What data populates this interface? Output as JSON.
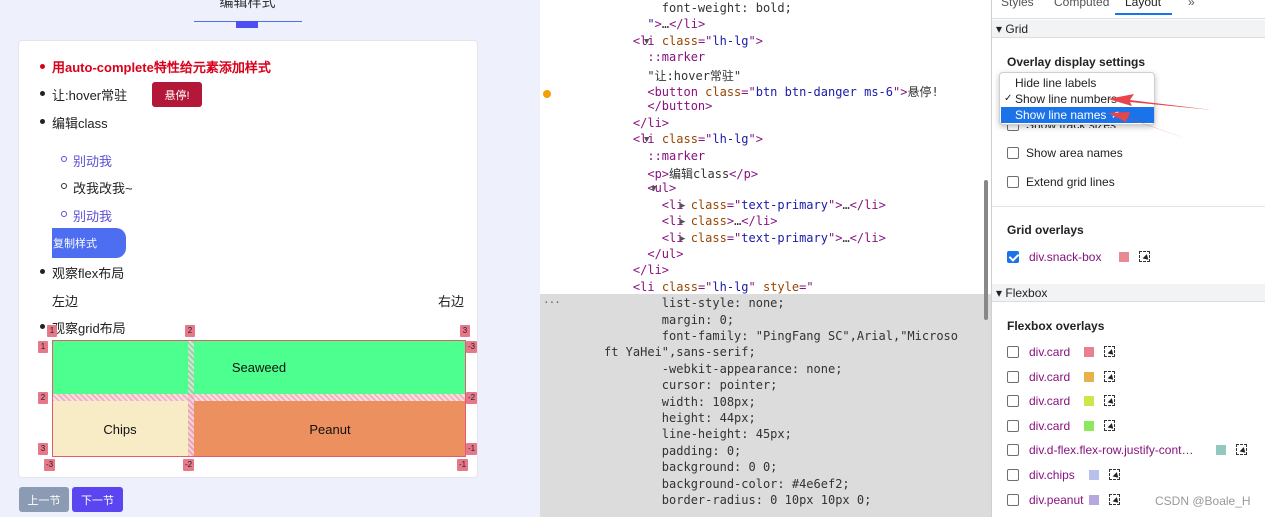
{
  "left": {
    "page_title": "编辑样式",
    "list": [
      {
        "text": "用auto-complete特性给元素添加样式"
      },
      {
        "text": "让:hover常驻",
        "button": "悬停!"
      },
      {
        "text": "编辑class"
      }
    ],
    "sublist": [
      "别动我",
      "改我改我~",
      "别动我"
    ],
    "copy_button": "复制样式",
    "flex_item": "观察flex布局",
    "flex_left": "左边",
    "flex_right": "右边",
    "grid_item": "观察grid布局",
    "grid_cells": {
      "seaweed": "Seaweed",
      "chips": "Chips",
      "peanut": "Peanut"
    },
    "grid_labels": {
      "top": [
        "1",
        "2",
        "3"
      ],
      "left": [
        "1",
        "2",
        "3"
      ],
      "right": [
        "-3",
        "-2",
        "-1"
      ],
      "bottom": [
        "-3",
        "-2",
        "-1"
      ]
    },
    "prev_button": "上一节",
    "next_button": "下一节"
  },
  "code": {
    "lines": [
      {
        "indent": "        ",
        "parts": [
          [
            "css",
            "font-weight: bold;"
          ]
        ]
      },
      {
        "indent": "      ",
        "parts": [
          [
            "av",
            "\""
          ],
          [
            "tag",
            ">"
          ],
          [
            "css",
            "…"
          ],
          [
            "tag",
            "</li>"
          ]
        ]
      },
      {
        "indent": "    ",
        "parts": [
          [
            "tag",
            "<li "
          ],
          [
            "an",
            "class"
          ],
          [
            "tag",
            "=\""
          ],
          [
            "av",
            "lh-lg"
          ],
          [
            "tag",
            "\">"
          ]
        ]
      },
      {
        "indent": "      ",
        "parts": [
          [
            "tag",
            "::marker"
          ]
        ]
      },
      {
        "indent": "      ",
        "parts": [
          [
            "css",
            "\"让:hover常驻\""
          ]
        ]
      },
      {
        "indent": "      ",
        "parts": [
          [
            "tag",
            "<button "
          ],
          [
            "an",
            "class"
          ],
          [
            "tag",
            "=\""
          ],
          [
            "av",
            "btn btn-danger ms-6"
          ],
          [
            "tag",
            "\">"
          ],
          [
            "css",
            "悬停!"
          ]
        ]
      },
      {
        "indent": "      ",
        "parts": [
          [
            "tag",
            "</button>"
          ]
        ]
      },
      {
        "indent": "    ",
        "parts": [
          [
            "tag",
            "</li>"
          ]
        ]
      },
      {
        "indent": "    ",
        "parts": [
          [
            "tag",
            "<li "
          ],
          [
            "an",
            "class"
          ],
          [
            "tag",
            "=\""
          ],
          [
            "av",
            "lh-lg"
          ],
          [
            "tag",
            "\">"
          ]
        ]
      },
      {
        "indent": "      ",
        "parts": [
          [
            "tag",
            "::marker"
          ]
        ]
      },
      {
        "indent": "      ",
        "parts": [
          [
            "tag",
            "<p>"
          ],
          [
            "css",
            "编辑class"
          ],
          [
            "tag",
            "</p>"
          ]
        ]
      },
      {
        "indent": "      ",
        "parts": [
          [
            "tag",
            "<ul>"
          ]
        ]
      },
      {
        "indent": "        ",
        "parts": [
          [
            "tag",
            "<li "
          ],
          [
            "an",
            "class"
          ],
          [
            "tag",
            "=\""
          ],
          [
            "av",
            "text-primary"
          ],
          [
            "tag",
            "\">"
          ],
          [
            "css",
            "…"
          ],
          [
            "tag",
            "</li>"
          ]
        ]
      },
      {
        "indent": "        ",
        "parts": [
          [
            "tag",
            "<li "
          ],
          [
            "an",
            "class"
          ],
          [
            "tag",
            ">"
          ],
          [
            "css",
            "…"
          ],
          [
            "tag",
            "</li>"
          ]
        ]
      },
      {
        "indent": "        ",
        "parts": [
          [
            "tag",
            "<li "
          ],
          [
            "an",
            "class"
          ],
          [
            "tag",
            "=\""
          ],
          [
            "av",
            "text-primary"
          ],
          [
            "tag",
            "\">"
          ],
          [
            "css",
            "…"
          ],
          [
            "tag",
            "</li>"
          ]
        ]
      },
      {
        "indent": "      ",
        "parts": [
          [
            "tag",
            "</ul>"
          ]
        ]
      },
      {
        "indent": "    ",
        "parts": [
          [
            "tag",
            "</li>"
          ]
        ]
      },
      {
        "indent": "    ",
        "parts": [
          [
            "tag",
            "<li "
          ],
          [
            "an",
            "class"
          ],
          [
            "tag",
            "=\""
          ],
          [
            "av",
            "lh-lg"
          ],
          [
            "tag",
            "\" "
          ],
          [
            "an",
            "style"
          ],
          [
            "tag",
            "=\""
          ]
        ]
      },
      {
        "indent": "        ",
        "parts": [
          [
            "css",
            "list-style: none;"
          ]
        ]
      },
      {
        "indent": "        ",
        "parts": [
          [
            "css",
            "margin: 0;"
          ]
        ]
      },
      {
        "indent": "        ",
        "parts": [
          [
            "css",
            "font-family: \"PingFang SC\",Arial,\"Microso"
          ]
        ]
      },
      {
        "indent": "",
        "parts": [
          [
            "css",
            "ft YaHei\",sans-serif;"
          ]
        ]
      },
      {
        "indent": "        ",
        "parts": [
          [
            "css",
            "-webkit-appearance: none;"
          ]
        ]
      },
      {
        "indent": "        ",
        "parts": [
          [
            "css",
            "cursor: pointer;"
          ]
        ]
      },
      {
        "indent": "        ",
        "parts": [
          [
            "css",
            "width: 108px;"
          ]
        ]
      },
      {
        "indent": "        ",
        "parts": [
          [
            "css",
            "height: 44px;"
          ]
        ]
      },
      {
        "indent": "        ",
        "parts": [
          [
            "css",
            "line-height: 45px;"
          ]
        ]
      },
      {
        "indent": "        ",
        "parts": [
          [
            "css",
            "padding: 0;"
          ]
        ]
      },
      {
        "indent": "        ",
        "parts": [
          [
            "css",
            "background: 0 0;"
          ]
        ]
      },
      {
        "indent": "        ",
        "parts": [
          [
            "css",
            "background-color: #4e6ef2;"
          ]
        ]
      },
      {
        "indent": "        ",
        "parts": [
          [
            "css",
            "border-radius: 0 10px 10px 0;"
          ]
        ]
      }
    ]
  },
  "right": {
    "tabs": [
      "Styles",
      "Computed",
      "Layout",
      "»"
    ],
    "grid_section": "Grid",
    "overlay_title": "Overlay display settings",
    "dropdown": [
      "Hide line labels",
      "Show line numbers",
      "Show line names"
    ],
    "overlay_options": [
      "Show track sizes",
      "Show area names",
      "Extend grid lines"
    ],
    "grid_overlays_title": "Grid overlays",
    "grid_overlay": {
      "name": "div.snack-box",
      "color": "#e78a93"
    },
    "flexbox_section": "Flexbox",
    "flexbox_overlays_title": "Flexbox overlays",
    "flex_items": [
      {
        "name": "div.card",
        "color": "#e8818f"
      },
      {
        "name": "div.card",
        "color": "#e6b24a"
      },
      {
        "name": "div.card",
        "color": "#c8e84b"
      },
      {
        "name": "div.card",
        "color": "#8ee85e"
      },
      {
        "name": "div.d-flex.flex-row.justify-cont…",
        "color": "#93c7c0"
      },
      {
        "name": "div.chips",
        "color": "#b9c0ee"
      },
      {
        "name": "div.peanut",
        "color": "#b8a6e0"
      }
    ],
    "watermark": "CSDN @Boale_H"
  }
}
